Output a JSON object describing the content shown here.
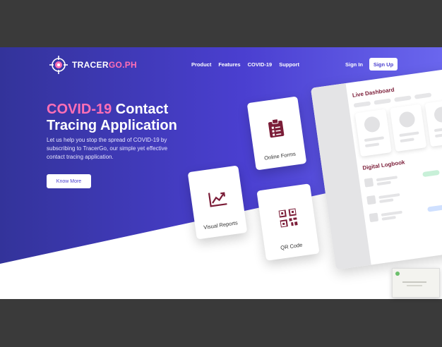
{
  "brand": {
    "name_part1": "TRACER",
    "name_part2": "GO.PH"
  },
  "nav": {
    "items": [
      "Product",
      "Features",
      "COVID-19",
      "Support"
    ]
  },
  "auth": {
    "signin": "Sign In",
    "signup": "Sign Up"
  },
  "hero": {
    "title_highlight": "COVID-19",
    "title_rest1": " Contact",
    "title_line2": "Tracing Application",
    "subtitle": "Let us help you stop the spread of COVID-19 by subscribing to TracerGo, our simple yet effective contact tracing application.",
    "cta": "Know More"
  },
  "cards": {
    "online_forms": "Online Forms",
    "visual_reports": "Visual Reports",
    "qr_code": "QR Code"
  },
  "dashboard": {
    "live": "Live Dashboard",
    "logbook": "Digital Logbook"
  },
  "colors": {
    "accent": "#4a3fd0",
    "pink": "#ff6fb5",
    "maroon": "#7b1d38"
  },
  "icons": {
    "logo": "crosshair-icon",
    "forms": "clipboard-icon",
    "reports": "trend-chart-icon",
    "qr": "qr-code-icon"
  }
}
